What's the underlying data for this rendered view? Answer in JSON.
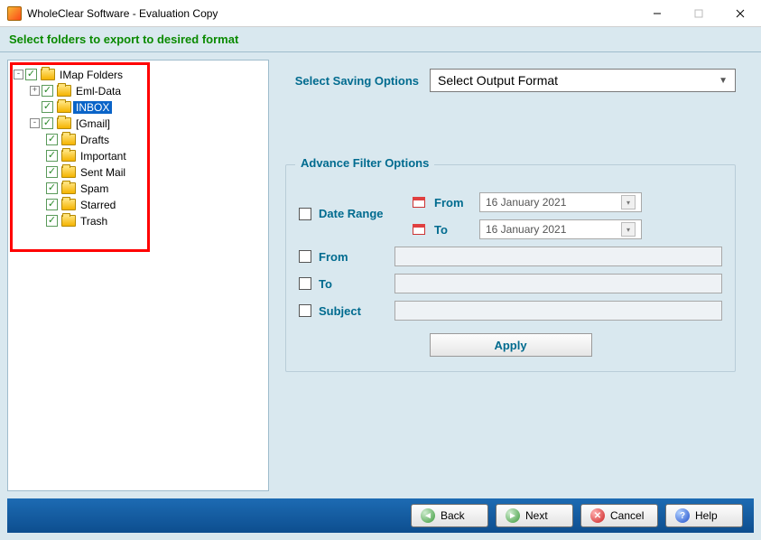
{
  "window": {
    "title": "WholeClear Software - Evaluation Copy"
  },
  "instruction": "Select folders to export to desired format",
  "tree": {
    "root": {
      "label": "IMap Folders",
      "children": [
        {
          "label": "Eml-Data",
          "expander": "+"
        },
        {
          "label": "INBOX",
          "selected": true
        },
        {
          "label": "[Gmail]",
          "expander": "-",
          "children": [
            {
              "label": "Drafts"
            },
            {
              "label": "Important"
            },
            {
              "label": "Sent Mail"
            },
            {
              "label": "Spam"
            },
            {
              "label": "Starred"
            },
            {
              "label": "Trash"
            }
          ]
        }
      ]
    }
  },
  "right": {
    "saving_label": "Select Saving Options",
    "combo_value": "Select Output Format",
    "filter_legend": "Advance Filter Options",
    "date_range_label": "Date Range",
    "from_date_label": "From",
    "to_date_label": "To",
    "from_date_value": "16   January   2021",
    "to_date_value": "16   January   2021",
    "from_label": "From",
    "to_label": "To",
    "subject_label": "Subject",
    "apply_label": "Apply"
  },
  "nav": {
    "back": "Back",
    "next": "Next",
    "cancel": "Cancel",
    "help": "Help"
  }
}
